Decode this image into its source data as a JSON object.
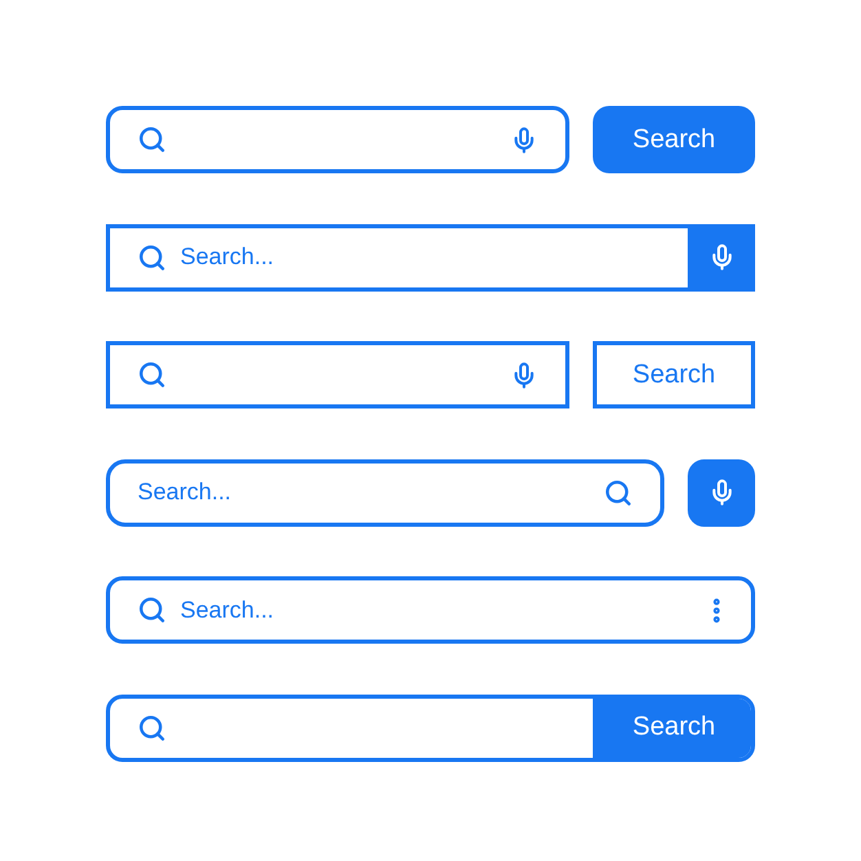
{
  "search_bars": [
    {
      "kind": "detached",
      "button": "Search"
    },
    {
      "kind": "attached-mic",
      "placeholder": "Search..."
    },
    {
      "kind": "outlined",
      "button": "Search"
    },
    {
      "kind": "pill",
      "placeholder": "Search..."
    },
    {
      "kind": "menu",
      "placeholder": "Search..."
    },
    {
      "kind": "attached-button",
      "button": "Search"
    }
  ]
}
